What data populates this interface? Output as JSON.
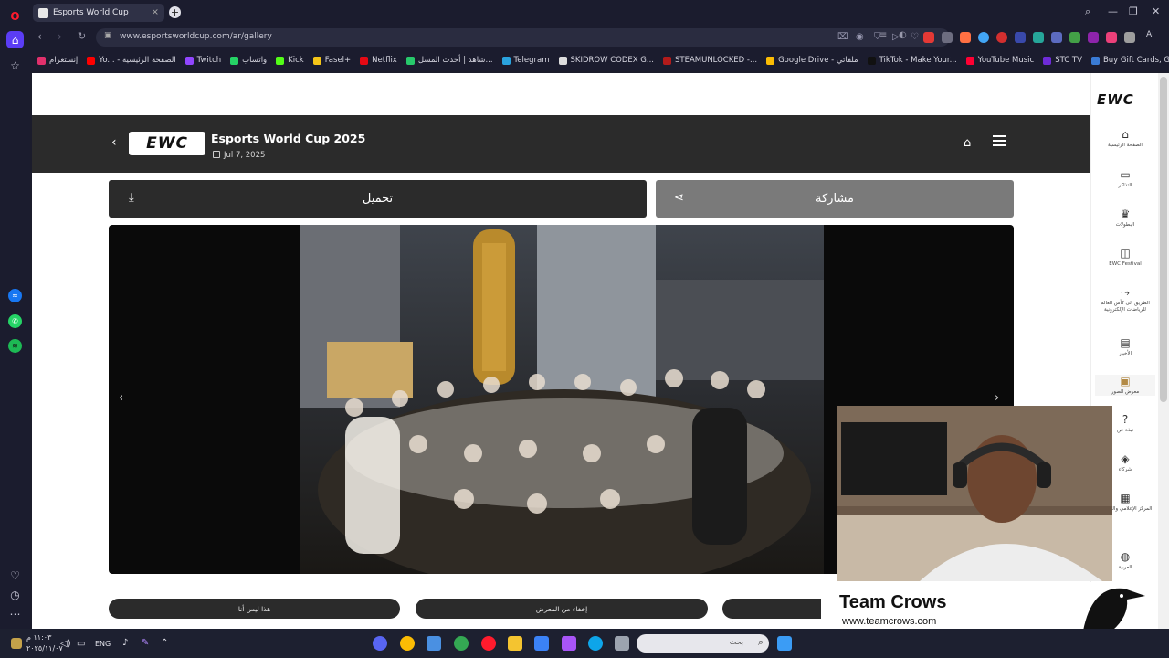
{
  "browser": {
    "tab_title": "Esports World Cup",
    "url": "www.esportsworldcup.com/ar/gallery",
    "ai_label": "Ai",
    "bookmarks": [
      {
        "label": "إنستغرام",
        "color": "#e1306c"
      },
      {
        "label": "Yo... - الصفحة الرئيسية",
        "color": "#ff0000"
      },
      {
        "label": "Twitch",
        "color": "#9146ff"
      },
      {
        "label": "واتساب",
        "color": "#25d366"
      },
      {
        "label": "Kick",
        "color": "#53fc18"
      },
      {
        "label": "Fasel+",
        "color": "#f5c518"
      },
      {
        "label": "Netflix",
        "color": "#e50914"
      },
      {
        "label": "شاهد | أحدث المسل...",
        "color": "#27c96b"
      },
      {
        "label": "Telegram",
        "color": "#2aa3df"
      },
      {
        "label": "SKIDROW CODEX G...",
        "color": "#dddddd"
      },
      {
        "label": "STEAMUNLOCKED -...",
        "color": "#b31b1b"
      },
      {
        "label": "Google Drive - ملفاتي",
        "color": "#fbbc04"
      },
      {
        "label": "TikTok - Make Your...",
        "color": "#111111"
      },
      {
        "label": "YouTube Music",
        "color": "#ff0033"
      },
      {
        "label": "STC TV",
        "color": "#6e2bd8"
      },
      {
        "label": "Buy Gift Cards, Gam...",
        "color": "#3a7bd5"
      }
    ]
  },
  "gallery": {
    "logo_text": "EWC",
    "title": "Esports World Cup 2025",
    "date": "Jul 7, 2025",
    "download_label": "تحميل",
    "share_label": "مشاركة",
    "pills": [
      "هذا ليس أنا",
      "إخفاء من المعرض"
    ]
  },
  "sidebar": {
    "logo_text": "EWC",
    "items": [
      {
        "label": "الصفحة الرئيسية",
        "icon": "home-icon",
        "glyph": "⌂"
      },
      {
        "label": "التذاكر",
        "icon": "ticket-icon",
        "glyph": "▭"
      },
      {
        "label": "البطولات",
        "icon": "trophy-icon",
        "glyph": "♛"
      },
      {
        "label": "EWC Festival",
        "icon": "gamepad-icon",
        "glyph": "◫"
      },
      {
        "label": "الطريق إلى كأس العالم للرياضات الإلكترونية",
        "icon": "route-icon",
        "glyph": "⤳"
      },
      {
        "label": "الأخبار",
        "icon": "news-icon",
        "glyph": "▤"
      },
      {
        "label": "معرض الصور",
        "icon": "gallery-icon",
        "glyph": "▣"
      },
      {
        "label": "نبذة عن",
        "icon": "help-icon",
        "glyph": "?"
      },
      {
        "label": "شركاء",
        "icon": "partners-icon",
        "glyph": "◈"
      },
      {
        "label": "المركز الإعلامي والصحفي",
        "icon": "media-icon",
        "glyph": "▦"
      },
      {
        "label": "العربية",
        "icon": "globe-icon",
        "glyph": "◍"
      }
    ],
    "active_index": 6
  },
  "overlay": {
    "brand_name": "Team Crows",
    "brand_url": "www.teamcrows.com"
  },
  "taskbar": {
    "time": "١١:٠٣ م",
    "date": "٢٠٢٥/١١/٠٧",
    "lang": "ENG",
    "search_placeholder": "بحث"
  }
}
